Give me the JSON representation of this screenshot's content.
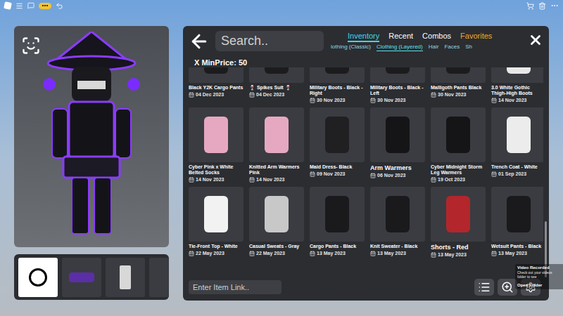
{
  "search": {
    "placeholder": "Search.."
  },
  "tabs": [
    {
      "label": "Inventory",
      "selected": true,
      "color": "#3fd6e8"
    },
    {
      "label": "Recent",
      "selected": false,
      "color": "#ffffff"
    },
    {
      "label": "Combos",
      "selected": false,
      "color": "#ffffff"
    },
    {
      "label": "Favorites",
      "selected": false,
      "color": "#f5a623"
    }
  ],
  "subtabs": [
    {
      "label": "lothing (Classic)",
      "selected": false
    },
    {
      "label": "Clothing (Layered)",
      "selected": true
    },
    {
      "label": "Hair",
      "selected": false
    },
    {
      "label": "Faces",
      "selected": false
    },
    {
      "label": "Sh",
      "selected": false
    }
  ],
  "filter": "X MinPrice: 50",
  "items": [
    {
      "name": "Black Y2K Cargo Pants",
      "date": "04 Dec 2023",
      "kind": "normal",
      "color": "#1c1c1e"
    },
    {
      "name": "🍷 Spikes Suit 🍷",
      "date": "04 Dec 2023",
      "kind": "normal",
      "color": "#1c1c1e"
    },
    {
      "name": "Military Boots - Black - Right",
      "date": "30 Nov 2023",
      "kind": "normal",
      "color": "#1c1c1e"
    },
    {
      "name": "Military Boots - Black - Left",
      "date": "30 Nov 2023",
      "kind": "normal",
      "color": "#1c1c1e"
    },
    {
      "name": "Malligoth Pants Black",
      "date": "30 Nov 2023",
      "kind": "normal",
      "color": "#1c1c1e"
    },
    {
      "name": "3.0 White Gothic Thigh-High Boots",
      "date": "14 Nov 2023",
      "kind": "normal",
      "color": "#e8e8e8"
    },
    {
      "name": "Cyber Pink x White Belted Socks",
      "date": "14 Nov 2023",
      "kind": "normal",
      "color": "#e6a8c0"
    },
    {
      "name": "Knitted Arm Warmers Pink",
      "date": "14 Nov 2023",
      "kind": "normal",
      "color": "#e6a8c0"
    },
    {
      "name": "Maid Dress- Black",
      "date": "09 Nov 2023",
      "kind": "normal",
      "color": "#202022"
    },
    {
      "name": "Arm Warmers",
      "date": "06 Nov 2023",
      "kind": "large",
      "color": "#151517"
    },
    {
      "name": "Cyber Midnight Storm Leg Warmers",
      "date": "19 Oct 2023",
      "kind": "normal",
      "color": "#151517"
    },
    {
      "name": "Trench Coat - White",
      "date": "01 Sep 2023",
      "kind": "normal",
      "color": "#ececec"
    },
    {
      "name": "Tie-Front Top - White",
      "date": "22 May 2023",
      "kind": "normal",
      "color": "#f2f2f2"
    },
    {
      "name": "Casual Sweats - Gray",
      "date": "22 May 2023",
      "kind": "normal",
      "color": "#c8c8c8"
    },
    {
      "name": "Cargo Pants - Black",
      "date": "13 May 2023",
      "kind": "normal",
      "color": "#1a1a1c"
    },
    {
      "name": "Knit Sweater - Black",
      "date": "13 May 2023",
      "kind": "normal",
      "color": "#1a1a1c"
    },
    {
      "name": "Shorts - Red",
      "date": "13 May 2023",
      "kind": "large",
      "color": "#b3262b"
    },
    {
      "name": "Wetsuit Pants - Black",
      "date": "13 May 2023",
      "kind": "normal",
      "color": "#1a1a1c"
    }
  ],
  "link_input": {
    "placeholder": "Enter Item Link.."
  },
  "toast": {
    "title": "Video Recorded",
    "message": "Check out your videos folder to see",
    "action": "Open Folder"
  }
}
